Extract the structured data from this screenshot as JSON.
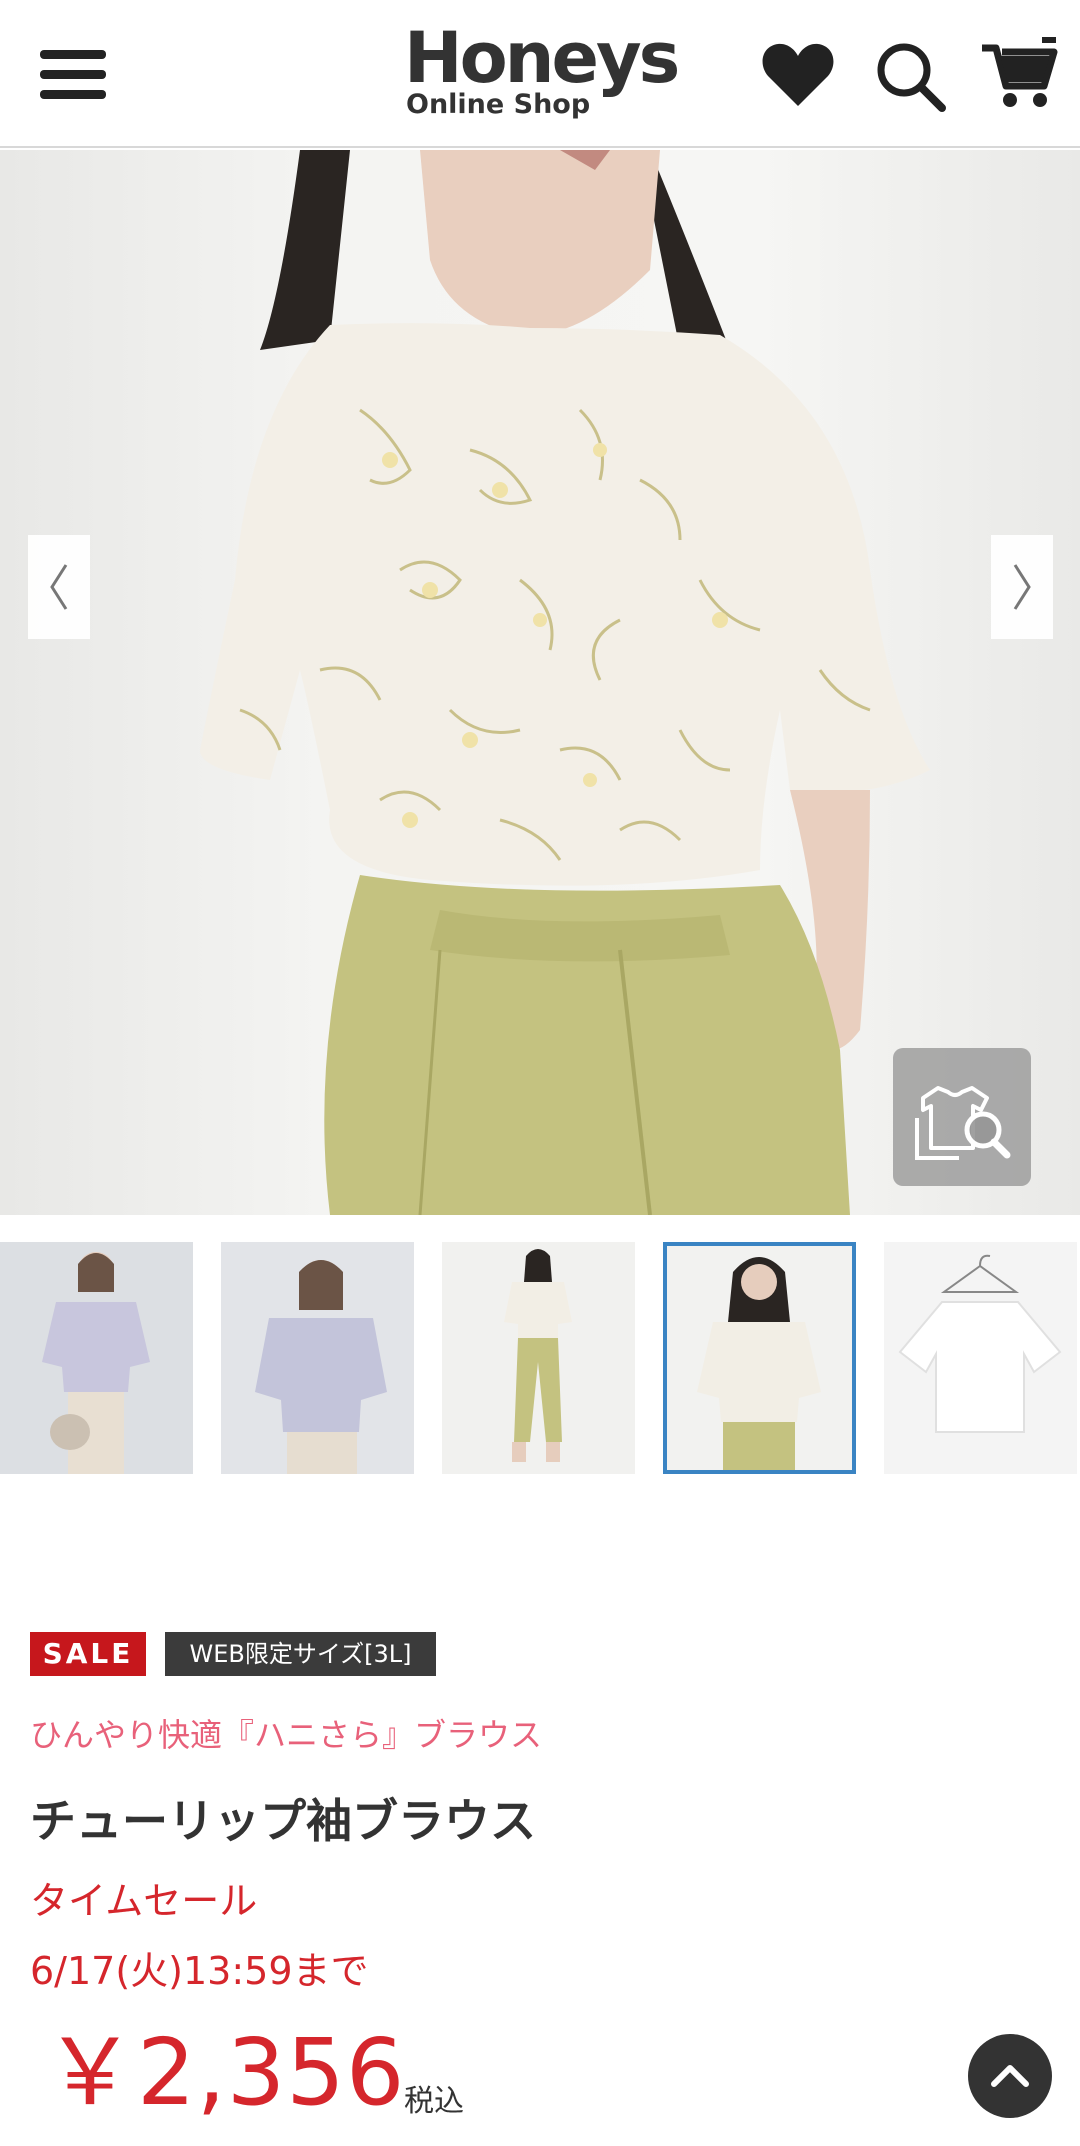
{
  "header": {
    "logo_main": "Honeys",
    "logo_sub": "Online Shop"
  },
  "gallery": {
    "prev_glyph": "〈",
    "next_glyph": "〉",
    "selected_thumb_index": 3,
    "thumb_count": 5
  },
  "product": {
    "badges": {
      "sale": "SALE",
      "web": "WEB限定サイズ[3L]"
    },
    "catch_copy": "ひんやり快適『ハニさら』ブラウス",
    "name": "チューリップ袖ブラウス",
    "time_sale_label": "タイムセール",
    "time_sale_deadline": "6/17(火)13:59まで",
    "price": "￥2,356",
    "tax_label": "税込"
  },
  "colors": {
    "sale_red": "#c6171c",
    "price_red": "#d5262c",
    "catch_pink": "#e8617a",
    "selected_border": "#3a84c3"
  },
  "icons": [
    "menu-icon",
    "heart-icon",
    "search-icon",
    "cart-icon",
    "chevron-left-icon",
    "chevron-right-icon",
    "zoom-clothes-icon",
    "arrow-up-icon"
  ]
}
